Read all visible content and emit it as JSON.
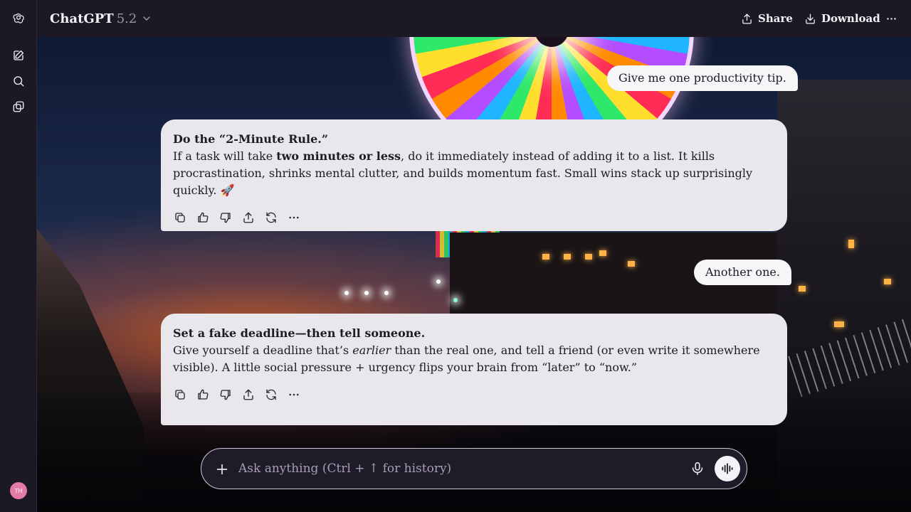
{
  "header": {
    "model_name": "ChatGPT",
    "model_version": "5.2",
    "share_label": "Share",
    "download_label": "Download"
  },
  "sidebar": {
    "icons": [
      "openai-logo-icon",
      "new-chat-icon",
      "search-icon",
      "gpts-icon"
    ],
    "avatar_initials": "TH"
  },
  "conversation": [
    {
      "role": "user",
      "text": "Give me one productivity tip."
    },
    {
      "role": "assistant",
      "title": "Do the “2-Minute Rule.”",
      "parts": [
        "If a task will take ",
        "two minutes or less",
        ", do it immediately instead of adding it to a list. It kills procrastination, shrinks mental clutter, and builds momentum fast. Small wins stack up surprisingly quickly. 🚀"
      ]
    },
    {
      "role": "user",
      "text": "Another one."
    },
    {
      "role": "assistant",
      "title": "Set a fake deadline—then tell someone.",
      "parts": [
        "Give yourself a deadline that’s ",
        "earlier",
        " than the real one, and tell a friend (or even write it somewhere visible). A little social pressure + urgency flips your brain from “later” to “now.”"
      ]
    }
  ],
  "message_actions": [
    "copy-icon",
    "thumbs-up-icon",
    "thumbs-down-icon",
    "share-icon",
    "regenerate-icon",
    "more-icon"
  ],
  "composer": {
    "placeholder": "Ask anything (Ctrl + ↑ for history)"
  },
  "colors": {
    "sidebar_bg": "#1c1925",
    "user_bubble": "#f6f5f8",
    "assistant_bubble": "#e9e6ec",
    "composer_bg": "#1f1b29"
  }
}
